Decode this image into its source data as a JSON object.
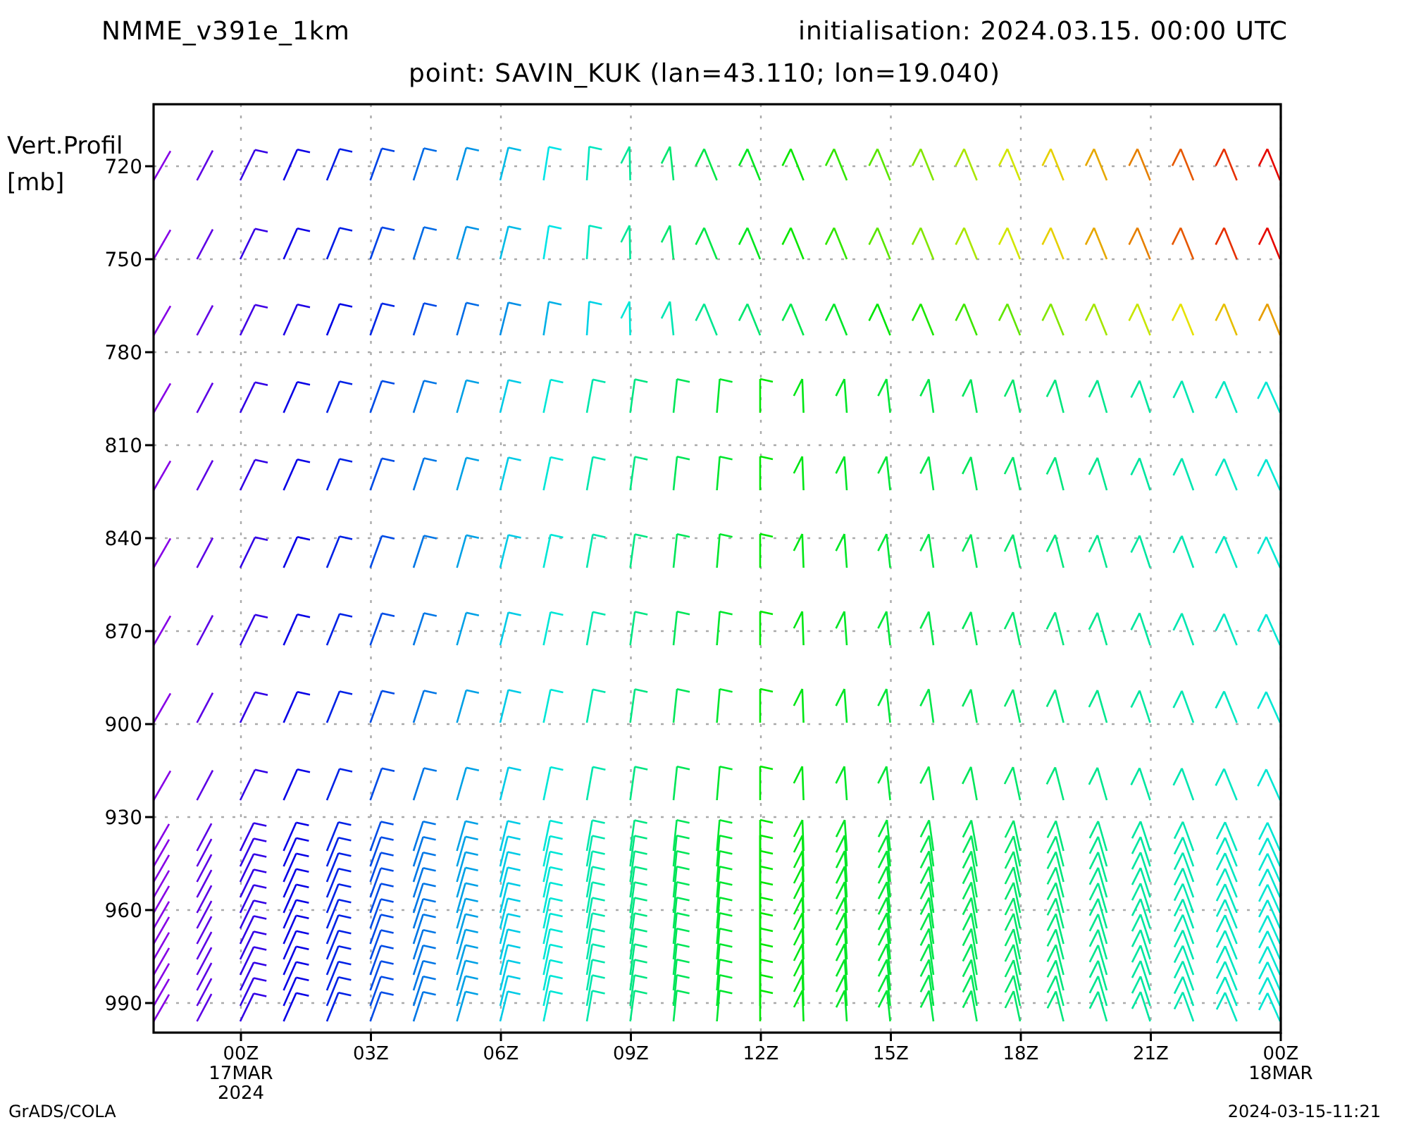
{
  "header": {
    "model": "NMME_v391e_1km",
    "initialisation": "initialisation: 2024.03.15. 00:00 UTC"
  },
  "subtitle": "point: SAVIN_KUK (lan=43.110; lon=19.040)",
  "y_axis": {
    "title": "Vert.Profil",
    "unit": "[mb]",
    "ticks": [
      "720",
      "750",
      "780",
      "810",
      "840",
      "870",
      "900",
      "930",
      "960",
      "990"
    ]
  },
  "x_axis": {
    "ticks": [
      {
        "label": "00Z",
        "lines": [
          "17MAR",
          "2024"
        ]
      },
      {
        "label": "03Z"
      },
      {
        "label": "06Z"
      },
      {
        "label": "09Z"
      },
      {
        "label": "12Z"
      },
      {
        "label": "15Z"
      },
      {
        "label": "18Z"
      },
      {
        "label": "21Z"
      },
      {
        "label": "00Z",
        "lines": [
          "18MAR"
        ]
      }
    ]
  },
  "footer": {
    "left": "GrADS/COLA",
    "right": "2024-03-15-11:21"
  }
}
